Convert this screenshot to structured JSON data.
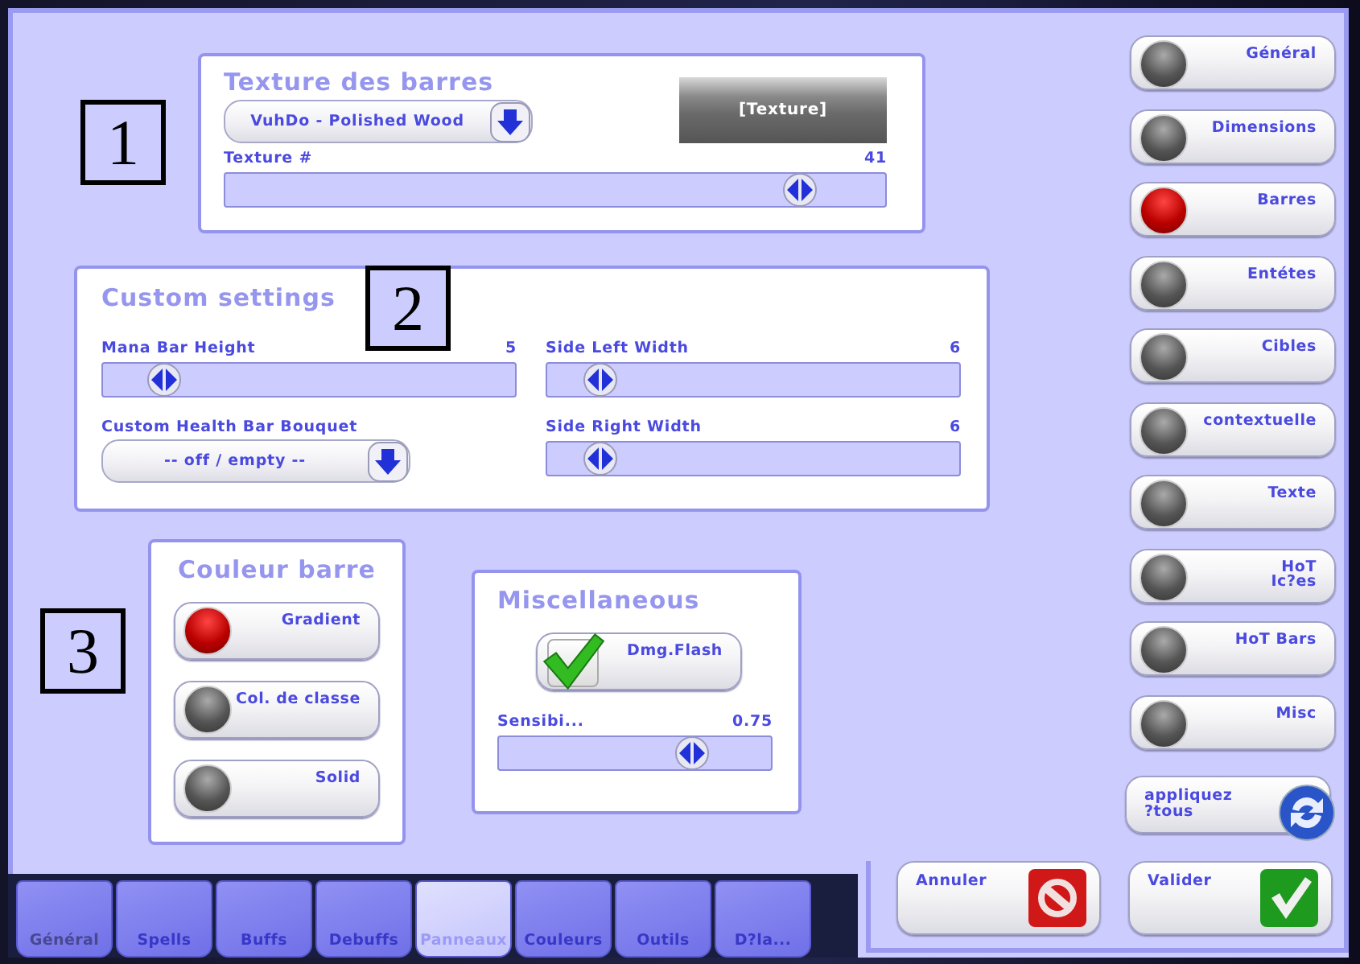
{
  "texture_panel": {
    "title": "Texture des barres",
    "marker": "1",
    "dropdown": {
      "value": "VuhDo - Polished Wood"
    },
    "preview": {
      "label": "[Texture]"
    },
    "slider": {
      "label": "Texture #",
      "reading": "41",
      "level": 0.87
    }
  },
  "custom_settings": {
    "title": "Custom settings",
    "marker": "2",
    "columns": [
      [
        {
          "kind": "slider",
          "label": "Mana Bar Height",
          "reading": "5",
          "level": 0.15
        },
        {
          "kind": "dropdown",
          "label": "Custom Health Bar Bouquet",
          "value": "-- off / empty --"
        }
      ],
      [
        {
          "kind": "slider",
          "label": "Side Left Width",
          "reading": "6",
          "level": 0.13
        },
        {
          "kind": "slider",
          "label": "Side Right Width",
          "reading": "6",
          "level": 0.13
        }
      ]
    ]
  },
  "bar_color": {
    "title": "Couleur barre",
    "marker": "3",
    "options": [
      {
        "label": "Gradient",
        "selected": true
      },
      {
        "label": "Col. de classe",
        "selected": false
      },
      {
        "label": "Solid",
        "selected": false
      }
    ]
  },
  "misc": {
    "title": "Miscellaneous",
    "checkbox": {
      "label": "Dmg.Flash",
      "checked": true
    },
    "slider": {
      "label": "Sensibi...",
      "reading": "0.75",
      "level": 0.71
    }
  },
  "sidebar": {
    "items": [
      {
        "label": "Général",
        "selected": false
      },
      {
        "label": "Dimensions",
        "selected": false
      },
      {
        "label": "Barres",
        "selected": true
      },
      {
        "label": "Entétes",
        "selected": false
      },
      {
        "label": "Cibles",
        "selected": false
      },
      {
        "label": "contextuelle",
        "selected": false
      },
      {
        "label": "Texte",
        "selected": false
      },
      {
        "label": "HoT\nIc?es",
        "selected": false
      },
      {
        "label": "HoT Bars",
        "selected": false
      },
      {
        "label": "Misc",
        "selected": false
      }
    ],
    "apply_button": "appliquez\n?tous"
  },
  "tabs": [
    {
      "label": "Général",
      "selected": false,
      "disabled": true
    },
    {
      "label": "Spells",
      "selected": false,
      "disabled": false
    },
    {
      "label": "Buffs",
      "selected": false,
      "disabled": false
    },
    {
      "label": "Debuffs",
      "selected": false,
      "disabled": false
    },
    {
      "label": "Panneaux",
      "selected": true,
      "disabled": false
    },
    {
      "label": "Couleurs",
      "selected": false,
      "disabled": false
    },
    {
      "label": "Outils",
      "selected": false,
      "disabled": false
    },
    {
      "label": "D?la...",
      "selected": false,
      "disabled": false
    }
  ],
  "buttons": [
    {
      "kind": "cancel",
      "label": "Annuler"
    },
    {
      "kind": "ok",
      "label": "Valider"
    }
  ]
}
